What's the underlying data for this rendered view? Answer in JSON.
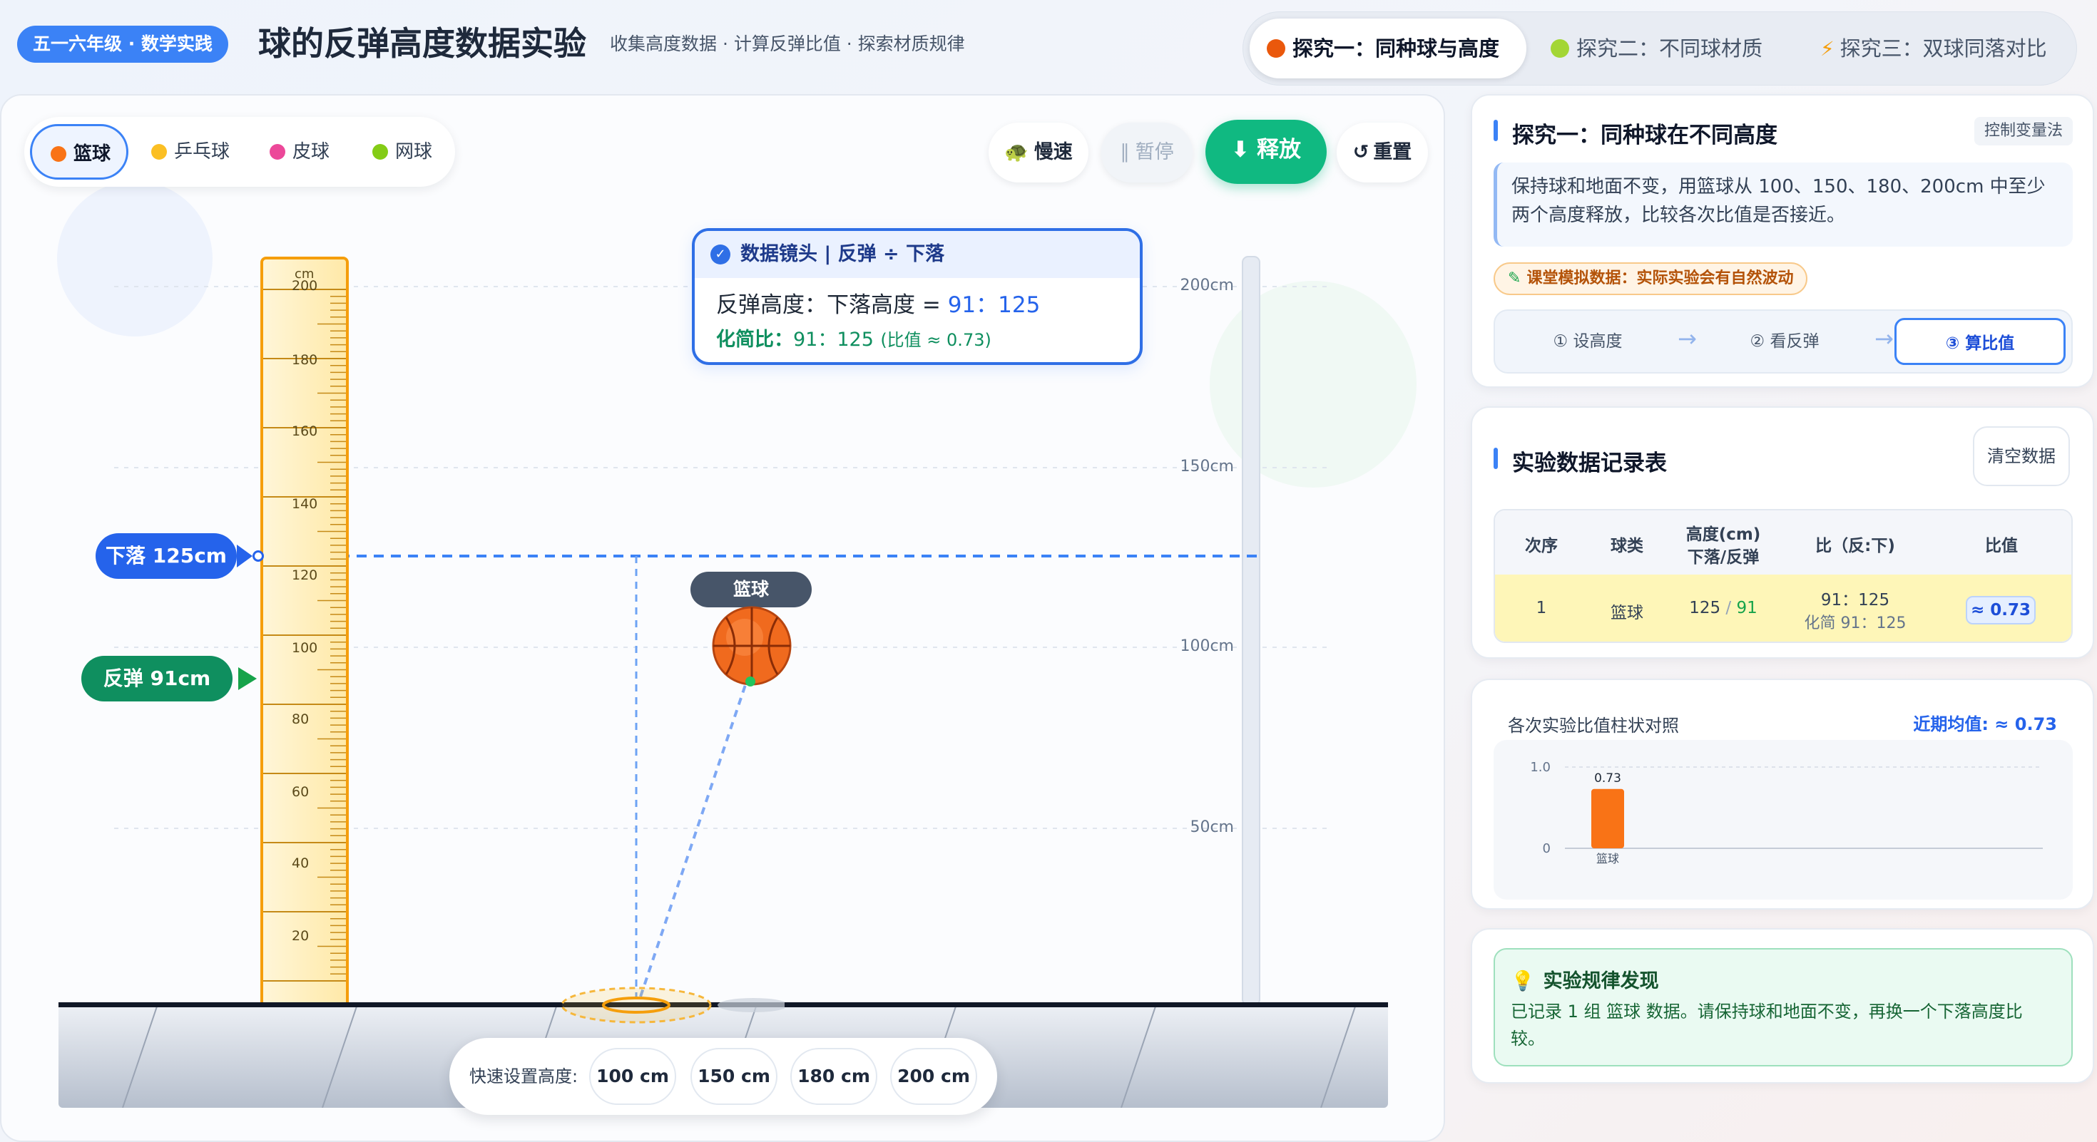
{
  "header": {
    "grade_badge": "五一六年级 · 数学实践",
    "title": "球的反弹高度数据实验",
    "subtitle": "收集高度数据 · 计算反弹比值 · 探索材质规律"
  },
  "tabs": [
    {
      "label": "探究一：同种球与高度",
      "icon": "basketball-icon",
      "color": "#ea580c",
      "active": true
    },
    {
      "label": "探究二：不同球材质",
      "icon": "tennis-ball-icon",
      "color": "#84cc16",
      "active": false
    },
    {
      "label": "探究三：双球同落对比",
      "icon": "lightning-icon",
      "color": "#f59e0b",
      "active": false
    }
  ],
  "ball_selector": [
    {
      "label": "篮球",
      "color": "#f97316",
      "active": true
    },
    {
      "label": "乒乓球",
      "color": "#fbbf24",
      "active": false
    },
    {
      "label": "皮球",
      "color": "#ec4899",
      "active": false
    },
    {
      "label": "网球",
      "color": "#84cc16",
      "active": false
    }
  ],
  "controls": {
    "slow": "慢速",
    "pause": "暂停",
    "release": "释放",
    "reset": "重置"
  },
  "ruler": {
    "unit": "cm",
    "labels": [
      "200",
      "180",
      "160",
      "140",
      "120",
      "100",
      "80",
      "60",
      "40",
      "20"
    ]
  },
  "scale_labels": [
    "200cm",
    "150cm",
    "100cm",
    "50cm"
  ],
  "markers": {
    "drop": "下落 125cm",
    "bounce": "反弹 91cm"
  },
  "lens": {
    "title": "数据镜头 | 反弹 ÷ 下落",
    "line1_prefix": "反弹高度：下落高度 = ",
    "line1_value": "91：125",
    "line2_prefix": "化简比：",
    "line2_value": "91：125",
    "line2_note": "(比值 ≈ 0.73)"
  },
  "ball_tag": "篮球",
  "quick_set": {
    "label": "快速设置高度:",
    "options": [
      "100 cm",
      "150 cm",
      "180 cm",
      "200 cm"
    ]
  },
  "info_card": {
    "title": "探究一：同种球在不同高度",
    "method_tag": "控制变量法",
    "description": "保持球和地面不变，用篮球从 100、150、180、200cm 中至少两个高度释放，比较各次比值是否接近。",
    "warning": "课堂模拟数据：实际实验会有自然波动",
    "steps": [
      "① 设高度",
      "② 看反弹",
      "③ 算比值"
    ],
    "arrow": "→"
  },
  "data_table": {
    "title": "实验数据记录表",
    "clear_label": "清空数据",
    "headers": {
      "index": "次序",
      "ball": "球类",
      "height_1": "高度(cm)",
      "height_2": "下落/反弹",
      "ratio": "比（反:下)",
      "value": "比值"
    },
    "rows": [
      {
        "index": "1",
        "ball": "篮球",
        "drop": "125",
        "sep": " / ",
        "bounce": "91",
        "ratio": "91：125",
        "simplified": "化简 91：125",
        "value": "≈ 0.73"
      }
    ]
  },
  "chart_card": {
    "title": "各次实验比值柱状对照",
    "avg_label": "近期均值: ≈ 0.73"
  },
  "chart_data": {
    "type": "bar",
    "categories": [
      "篮球"
    ],
    "values": [
      0.73
    ],
    "data_labels": [
      "0.73"
    ],
    "ylim": [
      0,
      1.0
    ],
    "y_ticks": [
      "0",
      "1.0"
    ],
    "bar_color": "#f97316",
    "grid": true
  },
  "finding_card": {
    "title": "实验规律发现",
    "text": "已记录 1 组 篮球 数据。请保持球和地面不变，再换一个下落高度比较。"
  },
  "colors": {
    "primary": "#3b82f6",
    "release": "#10b981",
    "drop_marker": "#2563eb",
    "bounce_marker": "#0f8f5f",
    "ruler": "#f59e0b",
    "ball": "#f97316"
  }
}
